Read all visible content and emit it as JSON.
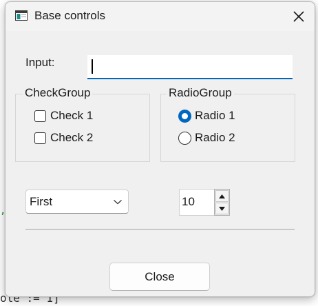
{
  "window": {
    "title": "Base controls",
    "title_icon": "app-window-icon",
    "close_icon": "close-icon"
  },
  "input": {
    "label": "Input:",
    "value": ""
  },
  "check_group": {
    "title": "CheckGroup",
    "items": [
      {
        "label": "Check 1",
        "checked": false
      },
      {
        "label": "Check 2",
        "checked": false
      }
    ]
  },
  "radio_group": {
    "title": "RadioGroup",
    "items": [
      {
        "label": "Radio 1",
        "selected": true
      },
      {
        "label": "Radio 2",
        "selected": false
      }
    ]
  },
  "combo": {
    "selected": "First",
    "arrow_icon": "chevron-down-icon"
  },
  "spinner": {
    "value": "10",
    "up_icon": "triangle-up-icon",
    "down_icon": "triangle-down-icon"
  },
  "close_button": {
    "label": "Close"
  },
  "colors": {
    "accent": "#0067c0",
    "window_bg": "#f0f0f0"
  }
}
